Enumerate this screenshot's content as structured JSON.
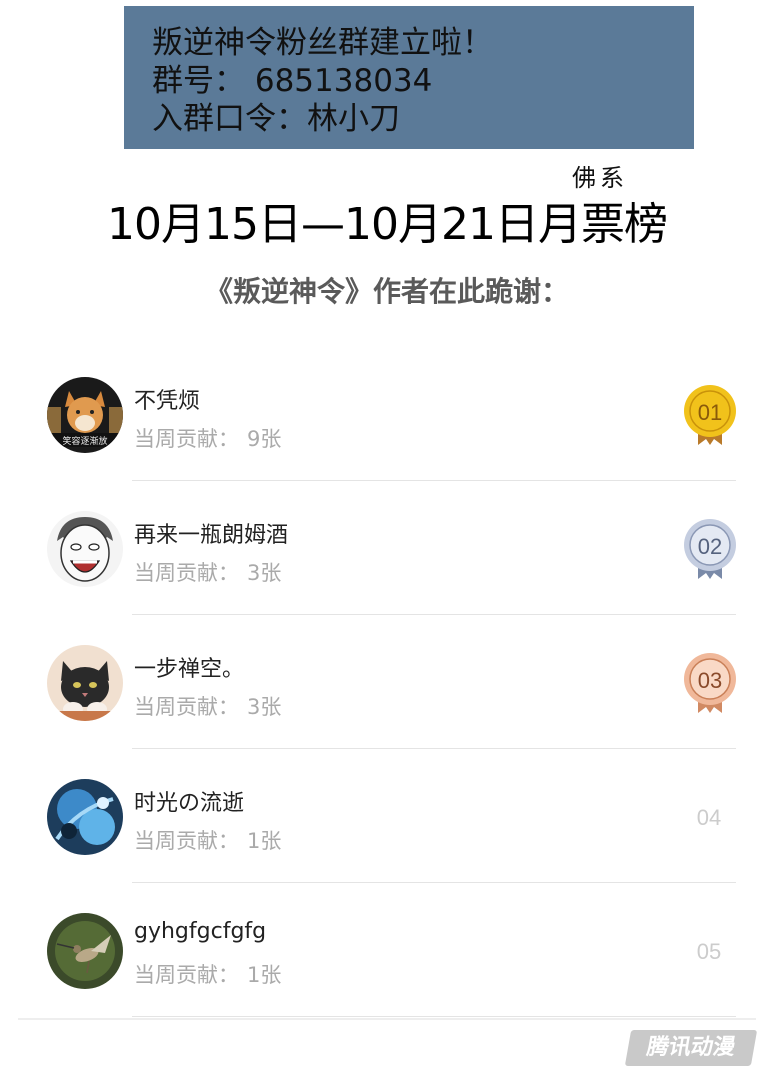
{
  "banner": {
    "line1": "叛逆神令粉丝群建立啦！",
    "line2": "群号： 685138034",
    "line3": "入群口令：林小刀"
  },
  "tag": "佛系",
  "title": "10月15日—10月21日月票榜",
  "thanks": "《叛逆神令》作者在此跪谢：",
  "contrib_label": "当周贡献：",
  "rows": [
    {
      "name": "不凭烦",
      "count": "9张",
      "rank": "01"
    },
    {
      "name": "再来一瓶朗姆酒",
      "count": "3张",
      "rank": "02"
    },
    {
      "name": "一步禅空。",
      "count": "3张",
      "rank": "03"
    },
    {
      "name": "时光の流逝",
      "count": "1张",
      "rank": "04"
    },
    {
      "name": "gyhgfgcfgfg",
      "count": "1张",
      "rank": "05"
    }
  ],
  "avatar_overlay_text": "笑容逐渐放",
  "watermark": "腾讯动漫",
  "colors": {
    "banner": "#5b7a98",
    "gold": "#f1c21b",
    "silver": "#c4cde0",
    "bronze": "#f0b89a"
  }
}
